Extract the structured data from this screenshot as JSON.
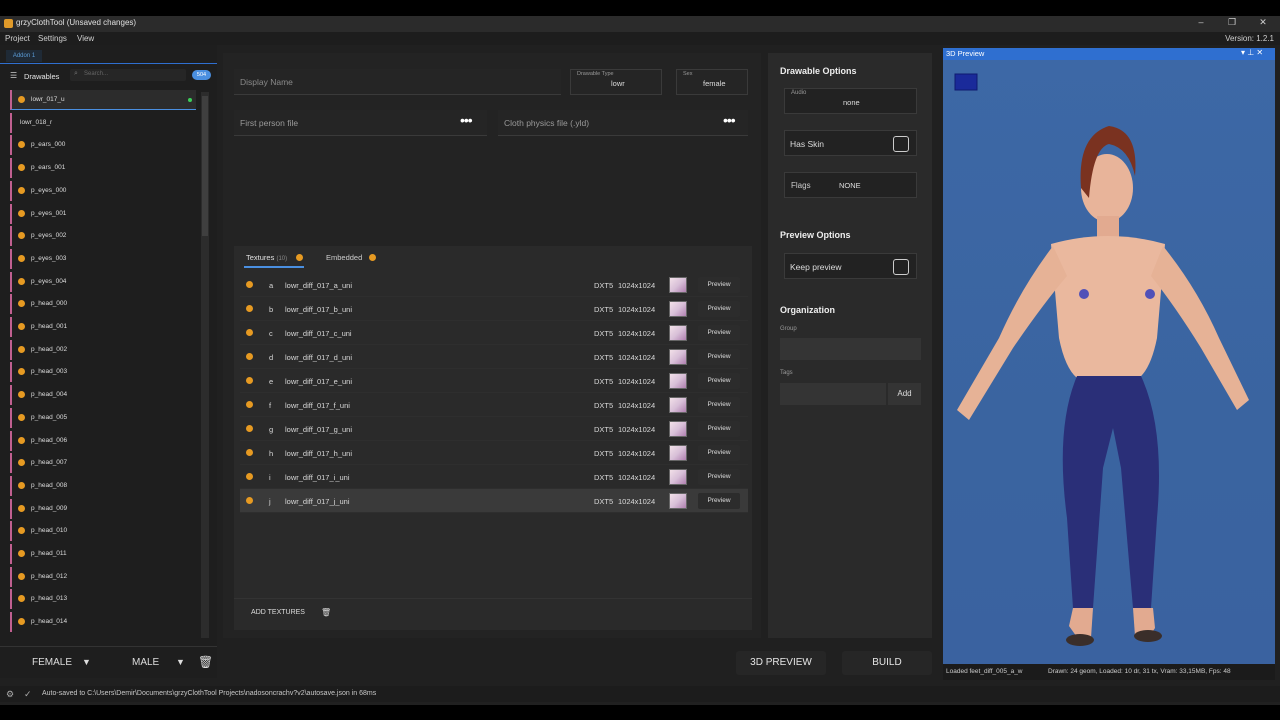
{
  "window": {
    "title": "grzyClothTool (Unsaved changes)",
    "version": "Version: 1.2.1"
  },
  "menu": [
    "Project",
    "Settings",
    "View"
  ],
  "left": {
    "addon_tab": "Addon 1",
    "header": "Drawables",
    "search_placeholder": "Search...",
    "count": "504",
    "items": [
      "lowr_017_u",
      "lowr_018_r",
      "p_ears_000",
      "p_ears_001",
      "p_eyes_000",
      "p_eyes_001",
      "p_eyes_002",
      "p_eyes_003",
      "p_eyes_004",
      "p_head_000",
      "p_head_001",
      "p_head_002",
      "p_head_003",
      "p_head_004",
      "p_head_005",
      "p_head_006",
      "p_head_007",
      "p_head_008",
      "p_head_009",
      "p_head_010",
      "p_head_011",
      "p_head_012",
      "p_head_013",
      "p_head_014"
    ],
    "footer": {
      "female": "FEMALE",
      "male": "MALE"
    }
  },
  "center": {
    "display_name_placeholder": "Display Name",
    "drawable_type_label": "Drawable Type",
    "drawable_type_value": "lowr",
    "sex_label": "Sex",
    "sex_value": "female",
    "first_person_placeholder": "First person file",
    "cloth_physics_placeholder": "Cloth physics file (.yld)",
    "tabs": {
      "textures": "Textures",
      "textures_count": "(10)",
      "embedded": "Embedded"
    },
    "textures": [
      {
        "letter": "a",
        "name": "lowr_diff_017_a_uni",
        "format": "DXT5",
        "res": "1024x1024",
        "preview": "Preview"
      },
      {
        "letter": "b",
        "name": "lowr_diff_017_b_uni",
        "format": "DXT5",
        "res": "1024x1024",
        "preview": "Preview"
      },
      {
        "letter": "c",
        "name": "lowr_diff_017_c_uni",
        "format": "DXT5",
        "res": "1024x1024",
        "preview": "Preview"
      },
      {
        "letter": "d",
        "name": "lowr_diff_017_d_uni",
        "format": "DXT5",
        "res": "1024x1024",
        "preview": "Preview"
      },
      {
        "letter": "e",
        "name": "lowr_diff_017_e_uni",
        "format": "DXT5",
        "res": "1024x1024",
        "preview": "Preview"
      },
      {
        "letter": "f",
        "name": "lowr_diff_017_f_uni",
        "format": "DXT5",
        "res": "1024x1024",
        "preview": "Preview"
      },
      {
        "letter": "g",
        "name": "lowr_diff_017_g_uni",
        "format": "DXT5",
        "res": "1024x1024",
        "preview": "Preview"
      },
      {
        "letter": "h",
        "name": "lowr_diff_017_h_uni",
        "format": "DXT5",
        "res": "1024x1024",
        "preview": "Preview"
      },
      {
        "letter": "i",
        "name": "lowr_diff_017_i_uni",
        "format": "DXT5",
        "res": "1024x1024",
        "preview": "Preview"
      },
      {
        "letter": "j",
        "name": "lowr_diff_017_j_uni",
        "format": "DXT5",
        "res": "1024x1024",
        "preview": "Preview"
      }
    ],
    "add_textures": "ADD TEXTURES"
  },
  "options": {
    "drawable_options": "Drawable Options",
    "audio_label": "Audio",
    "audio_value": "none",
    "has_skin": "Has Skin",
    "flags_label": "Flags",
    "flags_value": "NONE",
    "preview_options": "Preview Options",
    "keep_preview": "Keep preview",
    "organization": "Organization",
    "group_label": "Group",
    "tags_label": "Tags",
    "add": "Add"
  },
  "preview": {
    "title": "3D Preview",
    "status_left": "Loaded feet_diff_005_a_w",
    "status_right": "Drawn: 24 geom, Loaded: 10 dr, 31 tx, Vram: 33,15MB, Fps: 48"
  },
  "bottom": {
    "preview_btn": "3D PREVIEW",
    "build_btn": "BUILD"
  },
  "status": {
    "text": "Auto-saved to C:\\Users\\Demir\\Documents\\grzyClothTool Projects\\nadosoncrachv?v2\\autosave.json in 68ms"
  }
}
